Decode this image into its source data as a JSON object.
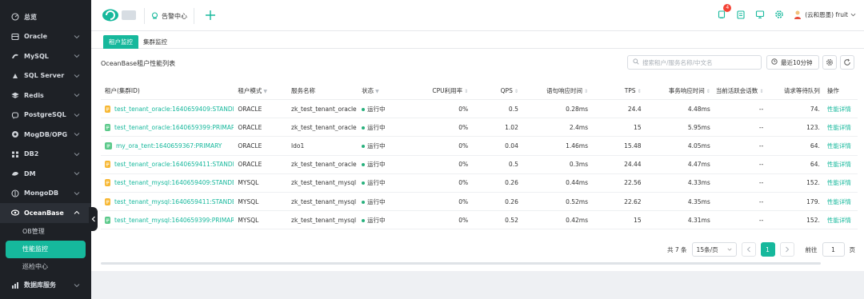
{
  "sidebar": {
    "items": [
      {
        "label": "总览",
        "icon": "dashboard-icon",
        "chevron": false
      },
      {
        "label": "Oracle",
        "icon": "database-icon",
        "chevron": true
      },
      {
        "label": "MySQL",
        "icon": "dolphin-icon",
        "chevron": true
      },
      {
        "label": "SQL Server",
        "icon": "sqlserver-icon",
        "chevron": true
      },
      {
        "label": "Redis",
        "icon": "redis-icon",
        "chevron": true
      },
      {
        "label": "PostgreSQL",
        "icon": "elephant-icon",
        "chevron": true
      },
      {
        "label": "MogDB/OPG",
        "icon": "mogdb-icon",
        "chevron": true
      },
      {
        "label": "DB2",
        "icon": "db2-icon",
        "chevron": true
      },
      {
        "label": "DM",
        "icon": "dm-icon",
        "chevron": true
      },
      {
        "label": "MongoDB",
        "icon": "leaf-icon",
        "chevron": true
      }
    ],
    "active_group": {
      "label": "OceanBase",
      "icon": "oceanbase-icon"
    },
    "sub_items": [
      {
        "label": "OB管理",
        "selected": false
      },
      {
        "label": "性能监控",
        "selected": true
      },
      {
        "label": "巡检中心",
        "selected": false
      }
    ],
    "bottom_item": {
      "label": "数据库服务",
      "icon": "service-icon"
    }
  },
  "topbar": {
    "alert_tab": "告警中心",
    "notification_count": "4",
    "user_name": "(云和恩墨) fruit"
  },
  "tabs": [
    {
      "label": "租户监控",
      "active": true
    },
    {
      "label": "集群监控",
      "active": false
    }
  ],
  "section_title": "OceanBase租户性能列表",
  "search": {
    "placeholder": "搜索租户/服务名称/中文名"
  },
  "time_range": "最近10分钟",
  "table": {
    "headers": [
      "租户(集群ID)",
      "租户模式",
      "服务名称",
      "状态",
      "CPU利用率",
      "QPS",
      "语句响应时间",
      "TPS",
      "事务响应时间",
      "当前活跃会话数",
      "请求等待队列",
      "操作"
    ],
    "rows": [
      {
        "tenant": "test_tenant_oracle:1640659409:STANDBY",
        "badge": "yellow",
        "mode": "ORACLE",
        "service": "zk_test_tenant_oracle",
        "status": "运行中",
        "cpu": "0%",
        "qps": "0.5",
        "stmt_rt": "0.28ms",
        "tps": "24.4",
        "trx_rt": "4.48ms",
        "sessions": "--",
        "queue": "74.",
        "action": "性能详情"
      },
      {
        "tenant": "test_tenant_oracle:1640659399:PRIMARY",
        "badge": "green",
        "mode": "ORACLE",
        "service": "zk_test_tenant_oracle",
        "status": "运行中",
        "cpu": "0%",
        "qps": "1.02",
        "stmt_rt": "2.4ms",
        "tps": "15",
        "trx_rt": "5.95ms",
        "sessions": "--",
        "queue": "123.",
        "action": "性能详情"
      },
      {
        "tenant": "my_ora_tent:1640659367:PRIMARY",
        "badge": "green",
        "mode": "ORACLE",
        "service": "ldo1",
        "status": "运行中",
        "cpu": "0%",
        "qps": "0.04",
        "stmt_rt": "1.46ms",
        "tps": "15.48",
        "trx_rt": "4.05ms",
        "sessions": "--",
        "queue": "64.",
        "action": "性能详情"
      },
      {
        "tenant": "test_tenant_oracle:1640659411:STANDBY",
        "badge": "yellow",
        "mode": "ORACLE",
        "service": "zk_test_tenant_oracle",
        "status": "运行中",
        "cpu": "0%",
        "qps": "0.5",
        "stmt_rt": "0.3ms",
        "tps": "24.44",
        "trx_rt": "4.47ms",
        "sessions": "--",
        "queue": "64.",
        "action": "性能详情"
      },
      {
        "tenant": "test_tenant_mysql:1640659409:STANDBY",
        "badge": "yellow",
        "mode": "MYSQL",
        "service": "zk_test_tenant_mysql",
        "status": "运行中",
        "cpu": "0%",
        "qps": "0.26",
        "stmt_rt": "0.44ms",
        "tps": "22.56",
        "trx_rt": "4.33ms",
        "sessions": "--",
        "queue": "152.",
        "action": "性能详情"
      },
      {
        "tenant": "test_tenant_mysql:1640659411:STANDBY",
        "badge": "yellow",
        "mode": "MYSQL",
        "service": "zk_test_tenant_mysql",
        "status": "运行中",
        "cpu": "0%",
        "qps": "0.26",
        "stmt_rt": "0.52ms",
        "tps": "22.62",
        "trx_rt": "4.35ms",
        "sessions": "--",
        "queue": "179.",
        "action": "性能详情"
      },
      {
        "tenant": "test_tenant_mysql:1640659399:PRIMARY",
        "badge": "green",
        "mode": "MYSQL",
        "service": "zk_test_tenant_mysql",
        "status": "运行中",
        "cpu": "0%",
        "qps": "0.52",
        "stmt_rt": "0.42ms",
        "tps": "15",
        "trx_rt": "4.31ms",
        "sessions": "--",
        "queue": "152.",
        "action": "性能详情"
      }
    ]
  },
  "pagination": {
    "total": "共 7 条",
    "page_size": "15条/页",
    "current_page": "1",
    "goto_label": "前往",
    "goto_value": "1",
    "page_suffix": "页"
  },
  "colors": {
    "accent": "#16b89c",
    "sidebar_bg": "#1e2126",
    "badge_yellow": "#f7b731",
    "badge_green": "#5bc98a",
    "alert_red": "#f44336"
  }
}
